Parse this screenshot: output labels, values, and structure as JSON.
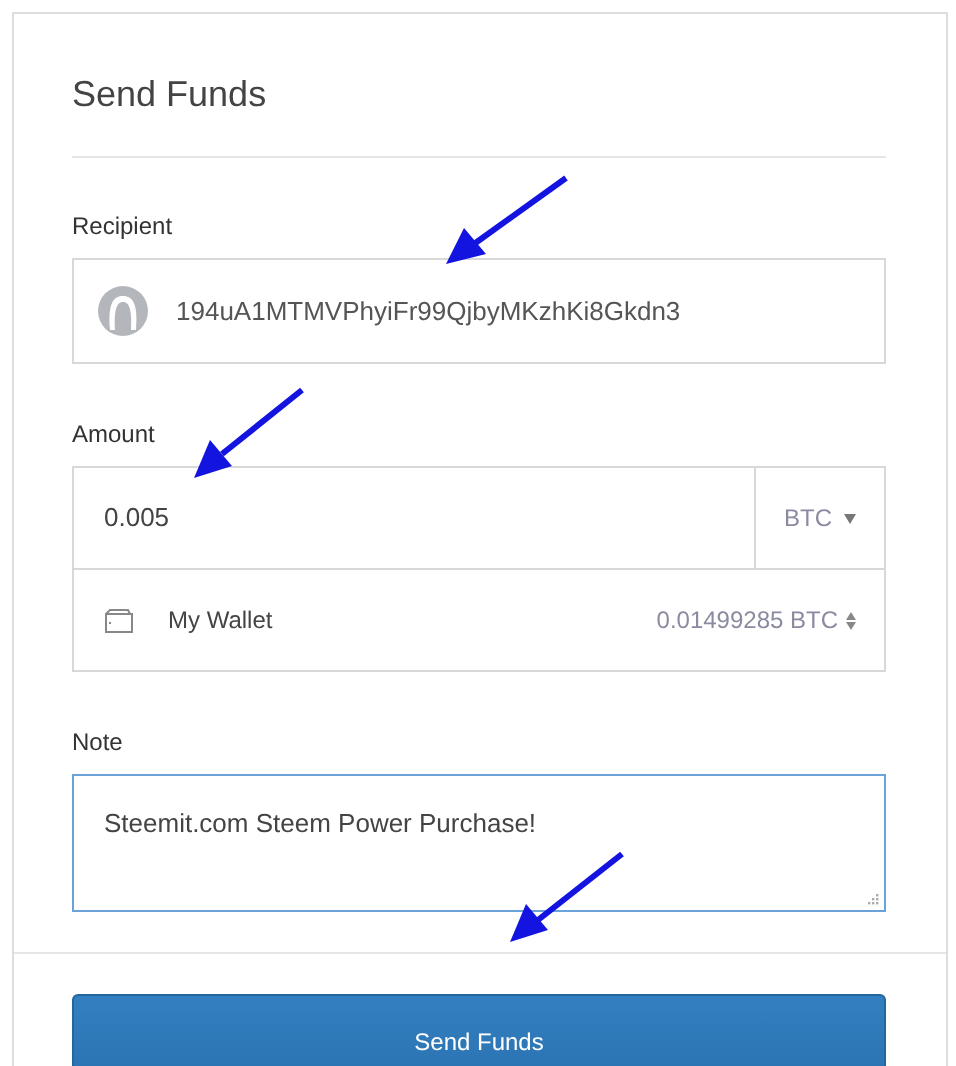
{
  "title": "Send Funds",
  "recipient": {
    "label": "Recipient",
    "value": "194uA1MTMVPhyiFr99QjbyMKzhKi8Gkdn3"
  },
  "amount": {
    "label": "Amount",
    "value": "0.005",
    "currency": "BTC"
  },
  "wallet": {
    "name": "My Wallet",
    "balance": "0.01499285 BTC"
  },
  "note": {
    "label": "Note",
    "value": "Steemit.com Steem Power Purchase!"
  },
  "submit": "Send Funds"
}
